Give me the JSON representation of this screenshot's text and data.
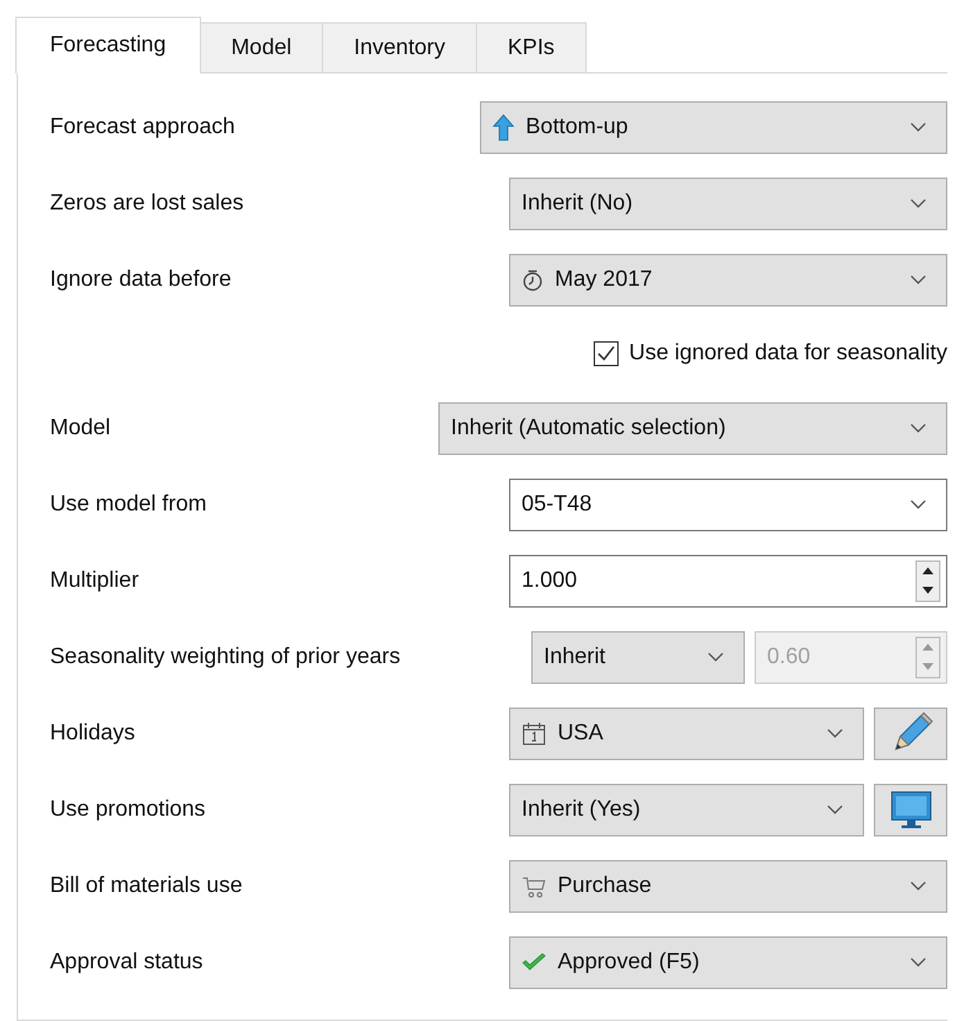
{
  "tabs": [
    {
      "label": "Forecasting",
      "selected": true
    },
    {
      "label": "Model",
      "selected": false
    },
    {
      "label": "Inventory",
      "selected": false
    },
    {
      "label": "KPIs",
      "selected": false
    }
  ],
  "rows": [
    {
      "kind": "combo",
      "label": "Forecast approach",
      "value": "Bottom-up"
    },
    {
      "kind": "combo",
      "label": "Zeros are lost sales",
      "value": "Inherit (No)"
    },
    {
      "kind": "combo",
      "label": "Ignore data before",
      "value": "May 2017"
    },
    {
      "kind": "check",
      "label": "Use ignored data for seasonality",
      "checked": true
    },
    {
      "kind": "combo",
      "label": "Model",
      "value": "Inherit (Automatic selection)"
    },
    {
      "kind": "editcombo",
      "label": "Use model from",
      "value": "05-T48"
    },
    {
      "kind": "spin",
      "label": "Multiplier",
      "value": "1.000",
      "disabled": false
    },
    {
      "kind": "combospin",
      "label": "Seasonality weighting of prior years",
      "value": "Inherit",
      "spin_value": "0.60",
      "disabled": true
    },
    {
      "kind": "combobutton",
      "label": "Holidays",
      "value": "USA"
    },
    {
      "kind": "combobutton",
      "label": "Use promotions",
      "value": "Inherit (Yes)"
    },
    {
      "kind": "combo",
      "label": "Bill of materials use",
      "value": "Purchase"
    },
    {
      "kind": "combo",
      "label": "Approval status",
      "value": "Approved (F5)"
    }
  ]
}
